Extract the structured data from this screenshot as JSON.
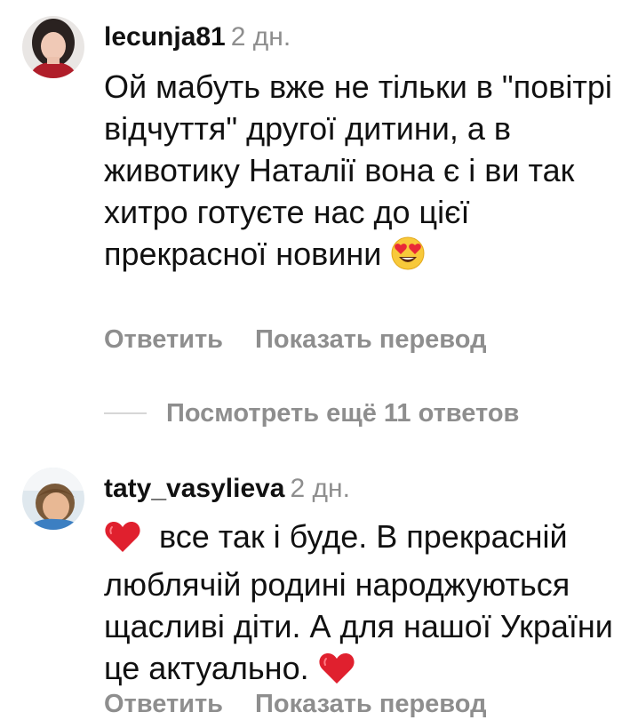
{
  "comments": [
    {
      "username": "lecunja81",
      "time": "2 дн.",
      "text": "Ой мабуть вже не тільки в \"повітрі відчуття\" другої дитини, а в животику Наталії вона є і ви так хитро готуєте нас до цієї прекрасної новини",
      "trailing_emoji": "heart-eyes",
      "reply_label": "Ответить",
      "translate_label": "Показать перевод"
    },
    {
      "username": "taty_vasylieva",
      "time": "2 дн.",
      "leading_emoji": "red-heart",
      "text": "все так і буде. В прекрасній люблячій родині народжуються щасливі діти. А для нашої України це актуально.",
      "trailing_emoji": "red-heart",
      "reply_label": "Ответить",
      "translate_label": "Показать перевод"
    }
  ],
  "view_more_replies": "Посмотреть ещё 11 ответов",
  "colors": {
    "primary_text": "#111111",
    "secondary_text": "#8e8e8e",
    "divider": "#d6d6d6",
    "heart": "#e0202e"
  }
}
